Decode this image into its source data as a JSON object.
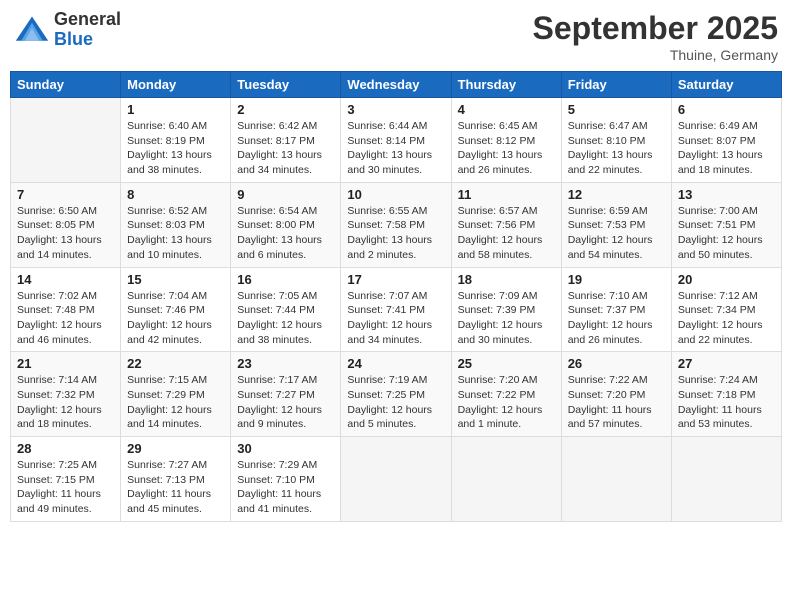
{
  "header": {
    "logo_general": "General",
    "logo_blue": "Blue",
    "title": "September 2025",
    "location": "Thuine, Germany"
  },
  "days_of_week": [
    "Sunday",
    "Monday",
    "Tuesday",
    "Wednesday",
    "Thursday",
    "Friday",
    "Saturday"
  ],
  "weeks": [
    [
      {
        "day": "",
        "sunrise": "",
        "sunset": "",
        "daylight": ""
      },
      {
        "day": "1",
        "sunrise": "Sunrise: 6:40 AM",
        "sunset": "Sunset: 8:19 PM",
        "daylight": "Daylight: 13 hours and 38 minutes."
      },
      {
        "day": "2",
        "sunrise": "Sunrise: 6:42 AM",
        "sunset": "Sunset: 8:17 PM",
        "daylight": "Daylight: 13 hours and 34 minutes."
      },
      {
        "day": "3",
        "sunrise": "Sunrise: 6:44 AM",
        "sunset": "Sunset: 8:14 PM",
        "daylight": "Daylight: 13 hours and 30 minutes."
      },
      {
        "day": "4",
        "sunrise": "Sunrise: 6:45 AM",
        "sunset": "Sunset: 8:12 PM",
        "daylight": "Daylight: 13 hours and 26 minutes."
      },
      {
        "day": "5",
        "sunrise": "Sunrise: 6:47 AM",
        "sunset": "Sunset: 8:10 PM",
        "daylight": "Daylight: 13 hours and 22 minutes."
      },
      {
        "day": "6",
        "sunrise": "Sunrise: 6:49 AM",
        "sunset": "Sunset: 8:07 PM",
        "daylight": "Daylight: 13 hours and 18 minutes."
      }
    ],
    [
      {
        "day": "7",
        "sunrise": "Sunrise: 6:50 AM",
        "sunset": "Sunset: 8:05 PM",
        "daylight": "Daylight: 13 hours and 14 minutes."
      },
      {
        "day": "8",
        "sunrise": "Sunrise: 6:52 AM",
        "sunset": "Sunset: 8:03 PM",
        "daylight": "Daylight: 13 hours and 10 minutes."
      },
      {
        "day": "9",
        "sunrise": "Sunrise: 6:54 AM",
        "sunset": "Sunset: 8:00 PM",
        "daylight": "Daylight: 13 hours and 6 minutes."
      },
      {
        "day": "10",
        "sunrise": "Sunrise: 6:55 AM",
        "sunset": "Sunset: 7:58 PM",
        "daylight": "Daylight: 13 hours and 2 minutes."
      },
      {
        "day": "11",
        "sunrise": "Sunrise: 6:57 AM",
        "sunset": "Sunset: 7:56 PM",
        "daylight": "Daylight: 12 hours and 58 minutes."
      },
      {
        "day": "12",
        "sunrise": "Sunrise: 6:59 AM",
        "sunset": "Sunset: 7:53 PM",
        "daylight": "Daylight: 12 hours and 54 minutes."
      },
      {
        "day": "13",
        "sunrise": "Sunrise: 7:00 AM",
        "sunset": "Sunset: 7:51 PM",
        "daylight": "Daylight: 12 hours and 50 minutes."
      }
    ],
    [
      {
        "day": "14",
        "sunrise": "Sunrise: 7:02 AM",
        "sunset": "Sunset: 7:48 PM",
        "daylight": "Daylight: 12 hours and 46 minutes."
      },
      {
        "day": "15",
        "sunrise": "Sunrise: 7:04 AM",
        "sunset": "Sunset: 7:46 PM",
        "daylight": "Daylight: 12 hours and 42 minutes."
      },
      {
        "day": "16",
        "sunrise": "Sunrise: 7:05 AM",
        "sunset": "Sunset: 7:44 PM",
        "daylight": "Daylight: 12 hours and 38 minutes."
      },
      {
        "day": "17",
        "sunrise": "Sunrise: 7:07 AM",
        "sunset": "Sunset: 7:41 PM",
        "daylight": "Daylight: 12 hours and 34 minutes."
      },
      {
        "day": "18",
        "sunrise": "Sunrise: 7:09 AM",
        "sunset": "Sunset: 7:39 PM",
        "daylight": "Daylight: 12 hours and 30 minutes."
      },
      {
        "day": "19",
        "sunrise": "Sunrise: 7:10 AM",
        "sunset": "Sunset: 7:37 PM",
        "daylight": "Daylight: 12 hours and 26 minutes."
      },
      {
        "day": "20",
        "sunrise": "Sunrise: 7:12 AM",
        "sunset": "Sunset: 7:34 PM",
        "daylight": "Daylight: 12 hours and 22 minutes."
      }
    ],
    [
      {
        "day": "21",
        "sunrise": "Sunrise: 7:14 AM",
        "sunset": "Sunset: 7:32 PM",
        "daylight": "Daylight: 12 hours and 18 minutes."
      },
      {
        "day": "22",
        "sunrise": "Sunrise: 7:15 AM",
        "sunset": "Sunset: 7:29 PM",
        "daylight": "Daylight: 12 hours and 14 minutes."
      },
      {
        "day": "23",
        "sunrise": "Sunrise: 7:17 AM",
        "sunset": "Sunset: 7:27 PM",
        "daylight": "Daylight: 12 hours and 9 minutes."
      },
      {
        "day": "24",
        "sunrise": "Sunrise: 7:19 AM",
        "sunset": "Sunset: 7:25 PM",
        "daylight": "Daylight: 12 hours and 5 minutes."
      },
      {
        "day": "25",
        "sunrise": "Sunrise: 7:20 AM",
        "sunset": "Sunset: 7:22 PM",
        "daylight": "Daylight: 12 hours and 1 minute."
      },
      {
        "day": "26",
        "sunrise": "Sunrise: 7:22 AM",
        "sunset": "Sunset: 7:20 PM",
        "daylight": "Daylight: 11 hours and 57 minutes."
      },
      {
        "day": "27",
        "sunrise": "Sunrise: 7:24 AM",
        "sunset": "Sunset: 7:18 PM",
        "daylight": "Daylight: 11 hours and 53 minutes."
      }
    ],
    [
      {
        "day": "28",
        "sunrise": "Sunrise: 7:25 AM",
        "sunset": "Sunset: 7:15 PM",
        "daylight": "Daylight: 11 hours and 49 minutes."
      },
      {
        "day": "29",
        "sunrise": "Sunrise: 7:27 AM",
        "sunset": "Sunset: 7:13 PM",
        "daylight": "Daylight: 11 hours and 45 minutes."
      },
      {
        "day": "30",
        "sunrise": "Sunrise: 7:29 AM",
        "sunset": "Sunset: 7:10 PM",
        "daylight": "Daylight: 11 hours and 41 minutes."
      },
      {
        "day": "",
        "sunrise": "",
        "sunset": "",
        "daylight": ""
      },
      {
        "day": "",
        "sunrise": "",
        "sunset": "",
        "daylight": ""
      },
      {
        "day": "",
        "sunrise": "",
        "sunset": "",
        "daylight": ""
      },
      {
        "day": "",
        "sunrise": "",
        "sunset": "",
        "daylight": ""
      }
    ]
  ]
}
